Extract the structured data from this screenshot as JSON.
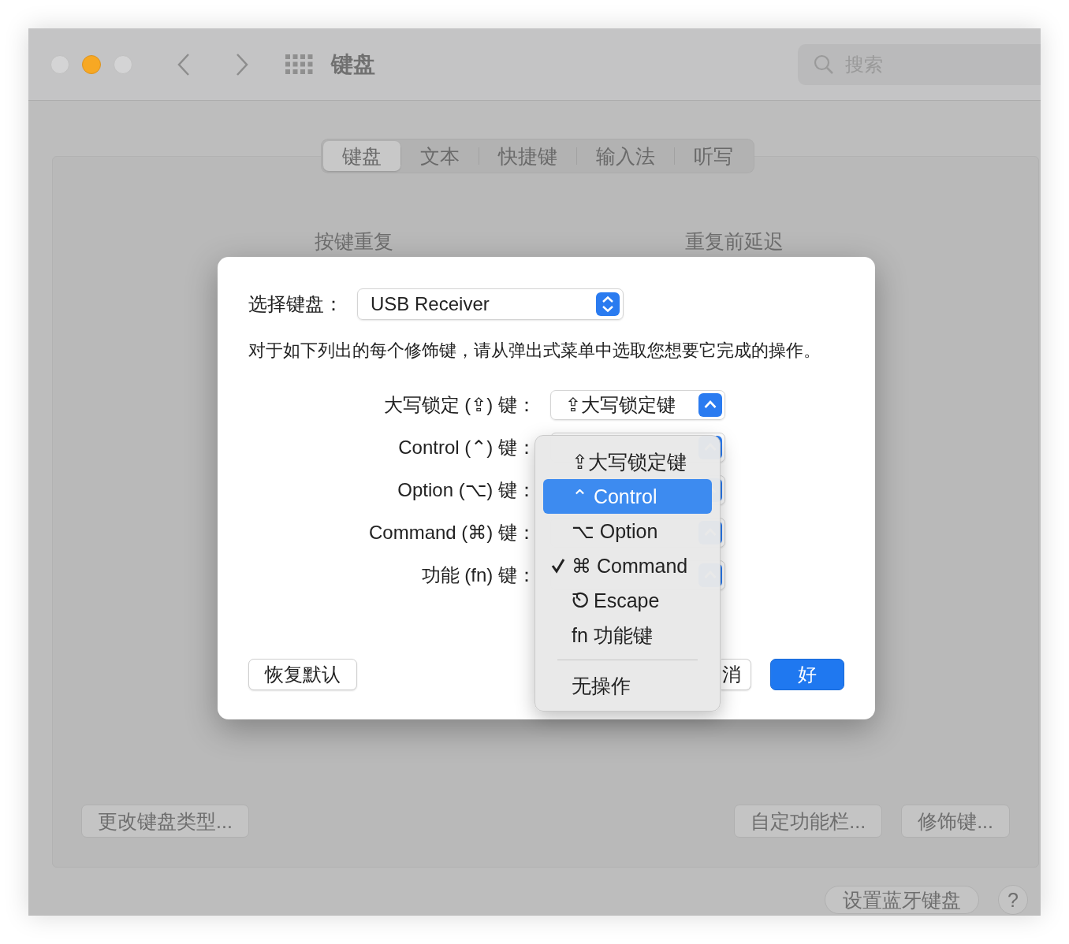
{
  "window": {
    "title": "键盘"
  },
  "search": {
    "placeholder": "搜索"
  },
  "tabs": [
    {
      "label": "键盘",
      "selected": true
    },
    {
      "label": "文本",
      "selected": false
    },
    {
      "label": "快捷键",
      "selected": false
    },
    {
      "label": "输入法",
      "selected": false
    },
    {
      "label": "听写",
      "selected": false
    }
  ],
  "section_labels": [
    "按键重复",
    "重复前延迟"
  ],
  "panel_buttons_left": [
    "更改键盘类型..."
  ],
  "panel_buttons_right": [
    "自定功能栏...",
    "修饰键..."
  ],
  "footer": {
    "button": "设置蓝牙键盘",
    "help": "?"
  },
  "dialog": {
    "keyboard_label": "选择键盘：",
    "keyboard_value": "USB Receiver",
    "description": "对于如下列出的每个修饰键，请从弹出式菜单中选取您想要它完成的操作。",
    "modifiers": [
      {
        "label": "大写锁定 (⇪) 键：",
        "value": "⇪大写锁定键"
      },
      {
        "label": "Control (⌃) 键："
      },
      {
        "label": "Option (⌥) 键："
      },
      {
        "label": "Command (⌘) 键："
      },
      {
        "label": "功能 (fn) 键："
      }
    ],
    "buttons": [
      {
        "label": "恢复默认",
        "kind": "plain"
      },
      {
        "label": "消",
        "kind": "plain"
      },
      {
        "label": "好",
        "kind": "default"
      }
    ]
  },
  "menu": {
    "items": [
      {
        "kind": "item",
        "label": "⇪大写锁定键",
        "selected": false,
        "checked": false
      },
      {
        "kind": "item",
        "label": "⌃ Control",
        "selected": true,
        "checked": false
      },
      {
        "kind": "item",
        "label": "⌥ Option",
        "selected": false,
        "checked": false
      },
      {
        "kind": "item",
        "label": "⌘ Command",
        "selected": false,
        "checked": true
      },
      {
        "kind": "escape",
        "label": "Escape",
        "selected": false,
        "checked": false
      },
      {
        "kind": "item",
        "label": "fn 功能键",
        "selected": false,
        "checked": false
      },
      {
        "kind": "separator"
      },
      {
        "kind": "item",
        "label": "无操作",
        "selected": false,
        "checked": false
      }
    ]
  }
}
